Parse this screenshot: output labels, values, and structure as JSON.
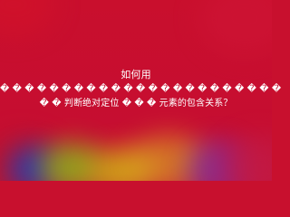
{
  "text": {
    "title": "如何用",
    "line1": "� � � � � � � � � � � � � � � � � � � � � � �",
    "line2": "� � 判断绝对定位 � � � 元素的包含关系？"
  },
  "colors": {
    "background": "#c8102e",
    "text": "#ffffff"
  }
}
